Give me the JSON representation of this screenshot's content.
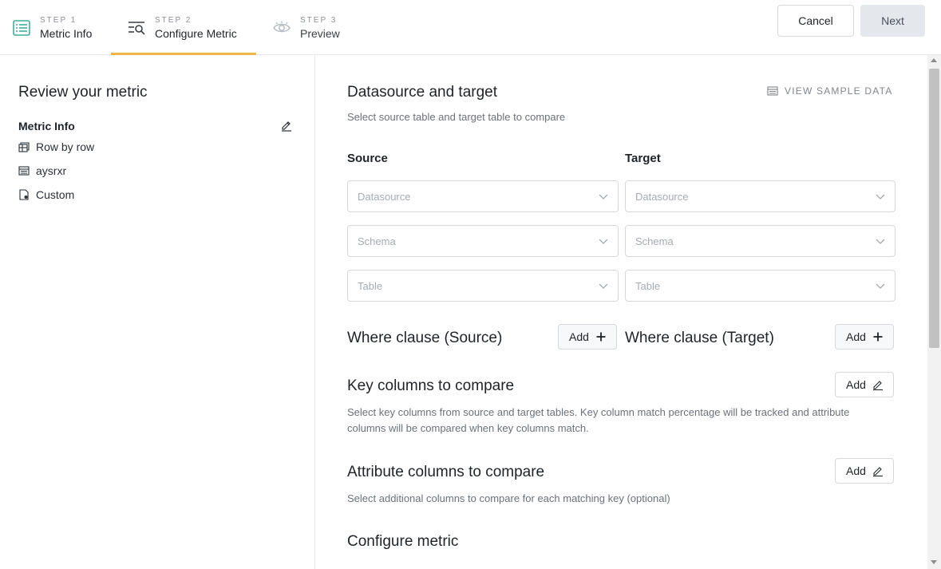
{
  "stepper": {
    "steps": [
      {
        "num": "STEP 1",
        "label": "Metric Info"
      },
      {
        "num": "STEP 2",
        "label": "Configure Metric"
      },
      {
        "num": "STEP 3",
        "label": "Preview"
      }
    ],
    "active_index": 1,
    "accent_color": "#f0b44c"
  },
  "actions": {
    "cancel_label": "Cancel",
    "next_label": "Next"
  },
  "review": {
    "title": "Review your metric",
    "metric_info_title": "Metric Info",
    "items": [
      {
        "icon": "row-by-row-icon",
        "label": "Row by row"
      },
      {
        "icon": "table-icon",
        "label": "aysrxr"
      },
      {
        "icon": "custom-doc-icon",
        "label": "Custom"
      }
    ]
  },
  "datasource": {
    "title": "Datasource and target",
    "subtitle": "Select source table and target table to compare",
    "view_sample_label": "VIEW SAMPLE DATA",
    "source_heading": "Source",
    "target_heading": "Target",
    "source_fields": [
      {
        "placeholder": "Datasource"
      },
      {
        "placeholder": "Schema"
      },
      {
        "placeholder": "Table"
      }
    ],
    "target_fields": [
      {
        "placeholder": "Datasource"
      },
      {
        "placeholder": "Schema"
      },
      {
        "placeholder": "Table"
      }
    ]
  },
  "where": {
    "source_title": "Where clause (Source)",
    "target_title": "Where clause (Target)",
    "add_label": "Add"
  },
  "key_columns": {
    "title": "Key columns to compare",
    "description_line1": "Select key columns from source and target tables. Key column match percentage will be tracked and attribute",
    "description_line2": "columns will be compared when key columns match.",
    "add_label": "Add"
  },
  "attribute_columns": {
    "title": "Attribute columns to compare",
    "description": "Select additional columns to compare for each matching key (optional)",
    "add_label": "Add"
  },
  "configure_metric": {
    "title": "Configure metric"
  }
}
